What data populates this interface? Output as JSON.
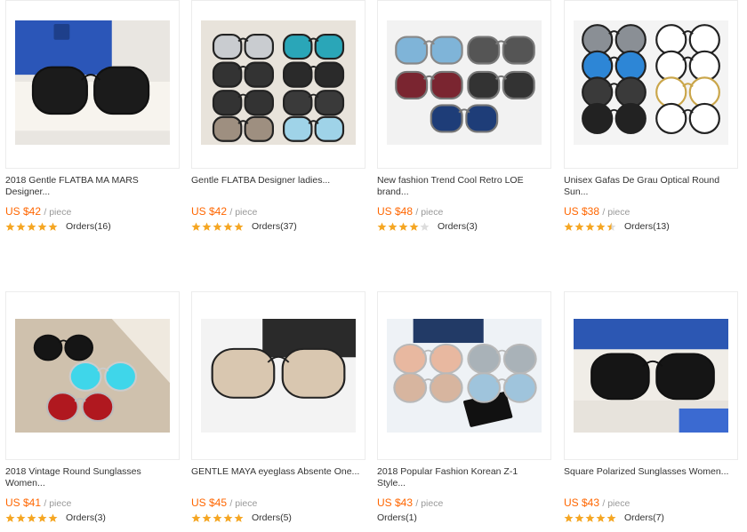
{
  "products": [
    {
      "title": "2018 Gentle FLATBA MA MARS Designer...",
      "price": "US $42",
      "unit": "/ piece",
      "rating": 5,
      "orders": "Orders(16)",
      "palette": "blue-box"
    },
    {
      "title": "Gentle FLATBA Designer ladies...",
      "price": "US $42",
      "unit": "/ piece",
      "rating": 5,
      "orders": "Orders(37)",
      "palette": "grid-9"
    },
    {
      "title": "New fashion Trend Cool Retro LOE brand...",
      "price": "US $48",
      "unit": "/ piece",
      "rating": 4,
      "orders": "Orders(3)",
      "palette": "retro-5"
    },
    {
      "title": "Unisex Gafas De Grau Optical Round Sun...",
      "price": "US $38",
      "unit": "/ piece",
      "rating": 4.5,
      "orders": "Orders(13)",
      "palette": "round-8"
    },
    {
      "title": "2018 Vintage Round Sunglasses Women...",
      "price": "US $41",
      "unit": "/ piece",
      "rating": 5,
      "orders": "Orders(3)",
      "palette": "vintage-3"
    },
    {
      "title": "GENTLE MAYA eyeglass Absente One...",
      "price": "US $45",
      "unit": "/ piece",
      "rating": 5,
      "orders": "Orders(5)",
      "palette": "maya-1"
    },
    {
      "title": "2018 Popular Fashion Korean Z-1 Style...",
      "price": "US $43",
      "unit": "/ piece",
      "rating": 0,
      "orders": "Orders(1)",
      "palette": "z1-6"
    },
    {
      "title": "Square Polarized Sunglasses Women...",
      "price": "US $43",
      "unit": "/ piece",
      "rating": 5,
      "orders": "Orders(7)",
      "palette": "square-1"
    }
  ],
  "colors": {
    "price": "#ff6600",
    "star": "#f5a623",
    "star_empty": "#dddddd"
  }
}
